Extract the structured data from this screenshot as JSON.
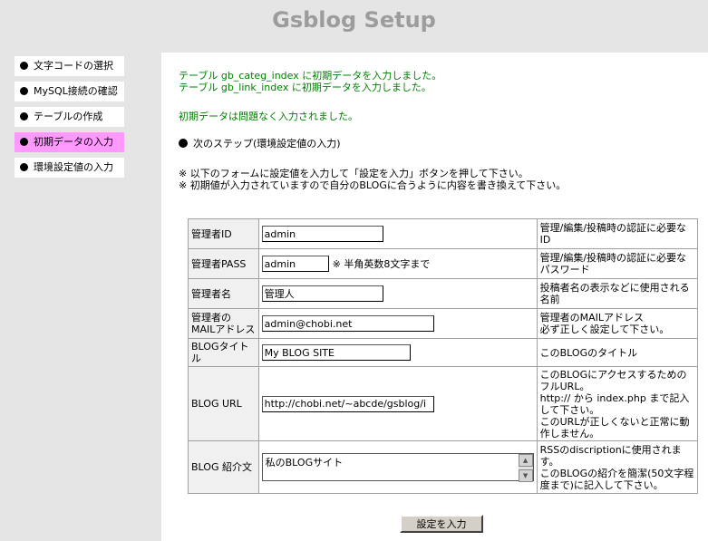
{
  "header": {
    "title": "Gsblog Setup"
  },
  "sidebar": {
    "items": [
      {
        "label": "文字コードの選択"
      },
      {
        "label": "MySQL接続の確認"
      },
      {
        "label": "テーブルの作成"
      },
      {
        "label": "初期データの入力",
        "active": true
      },
      {
        "label": "環境設定値の入力"
      }
    ]
  },
  "main": {
    "messages": [
      "テーブル gb_categ_index に初期データを入力しました。",
      "テーブル gb_link_index に初期データを入力しました。",
      "初期データは問題なく入力されました。"
    ],
    "next_step": "次のステップ(環境設定値の入力)",
    "instructions": [
      "※ 以下のフォームに設定値を入力して「設定を入力」ボタンを押して下さい。",
      "※ 初期値が入力されていますので自分のBLOGに合うように内容を書き換えて下さい。"
    ]
  },
  "form": {
    "admin_id": {
      "label": "管理者ID",
      "value": "admin",
      "desc": "管理/編集/投稿時の認証に必要なID"
    },
    "admin_pass": {
      "label": "管理者PASS",
      "value": "admin",
      "note": "※ 半角英数8文字まで",
      "desc": "管理/編集/投稿時の認証に必要なパスワード"
    },
    "admin_name": {
      "label": "管理者名",
      "value": "管理人",
      "desc": "投稿者名の表示などに使用される名前"
    },
    "admin_mail": {
      "label_1": "管理者の",
      "label_2": "MAILアドレス",
      "value": "admin@chobi.net",
      "desc_1": "管理者のMAILアドレス",
      "desc_2": "必ず正しく設定して下さい。"
    },
    "blog_title": {
      "label": "BLOGタイトル",
      "value": "My BLOG SITE",
      "desc": "このBLOGのタイトル"
    },
    "blog_url": {
      "label": "BLOG URL",
      "value": "http://chobi.net/~abcde/gsblog/i",
      "desc_1": "このBLOGにアクセスするためのフルURL。",
      "desc_2": "http:// から index.php まで記入して下さい。",
      "desc_3": "このURLが正しくないと正常に動作しません。"
    },
    "blog_intro": {
      "label": "BLOG 紹介文",
      "value": "私のBLOGサイト",
      "desc_1": "RSSのdiscriptionに使用されます。",
      "desc_2": "このBLOGの紹介を簡潔(50文字程度まで)に記入して下さい。"
    },
    "submit_label": "設定を入力"
  },
  "icons": {
    "bullet": "filled-circle",
    "scroll_up": "scroll-up-arrow",
    "scroll_down": "scroll-down-arrow"
  },
  "colors": {
    "active_step": "#ff99ff",
    "message": "#008000",
    "title": "#9c9c9c"
  }
}
